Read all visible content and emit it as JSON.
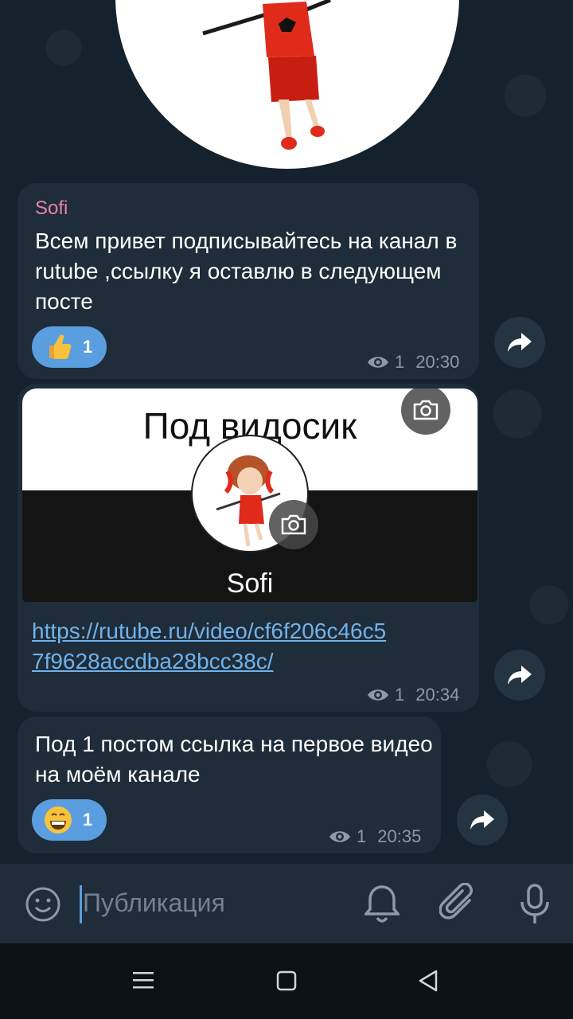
{
  "messages": [
    {
      "sender": "Sofi",
      "text": "Всем привет подписывайтесь на канал в rutube ,ссылку я оставлю в следующем посте",
      "reaction": {
        "emoji": "thumbs-up",
        "count": "1"
      },
      "views": "1",
      "time": "20:30"
    },
    {
      "preview_title": "Под видосик",
      "preview_name": "Sofi",
      "link": "https://rutube.ru/video/cf6f206c46c57f9628accdba28bcc38c/",
      "views": "1",
      "time": "20:34"
    },
    {
      "text": "Под 1 постом ссылка на первое видео на моём канале",
      "reaction": {
        "emoji": "grinning-face",
        "count": "1"
      },
      "views": "1",
      "time": "20:35"
    }
  ],
  "input": {
    "placeholder": "Публикация"
  },
  "colors": {
    "accent": "#5a9ee0",
    "sender": "#e884ab",
    "link": "#6fb3ec",
    "bubble": "#1f2c39"
  }
}
